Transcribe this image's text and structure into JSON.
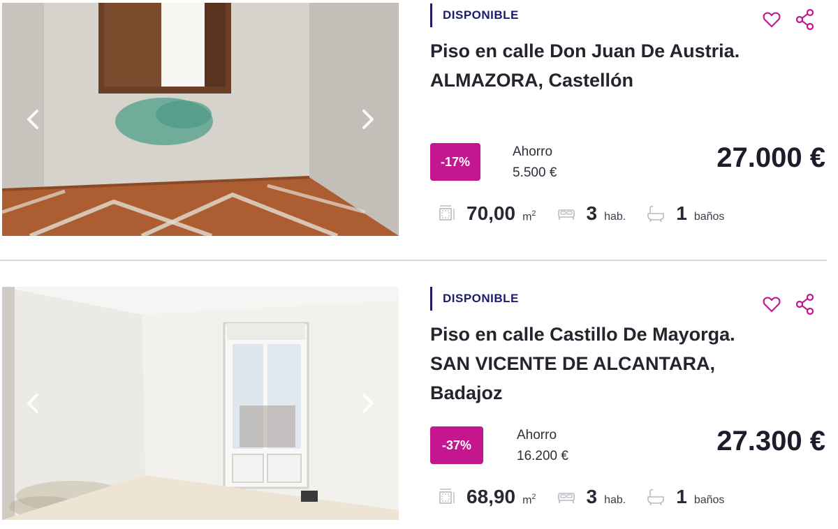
{
  "listings": [
    {
      "status": "DISPONIBLE",
      "title_line1": "Piso en calle Don Juan De Austria.",
      "title_line2": "ALMAZORA, Castellón",
      "title_line3": "",
      "discount": "-17%",
      "savings_label": "Ahorro",
      "savings_value": "5.500 €",
      "price": "27.000 €",
      "area": "70,00",
      "area_unit": "m",
      "area_sup": "2",
      "rooms": "3",
      "rooms_unit": "hab.",
      "baths": "1",
      "baths_unit": "baños",
      "icons": {
        "favorite": "heart-outline-icon",
        "share": "share-icon",
        "prev": "chevron-left-icon",
        "next": "chevron-right-icon",
        "area": "area-icon",
        "rooms": "bed-icon",
        "baths": "bathtub-icon"
      }
    },
    {
      "status": "DISPONIBLE",
      "title_line1": "Piso en calle Castillo De Mayorga.",
      "title_line2": "SAN VICENTE DE ALCANTARA,",
      "title_line3": "Badajoz",
      "discount": "-37%",
      "savings_label": "Ahorro",
      "savings_value": "16.200 €",
      "price": "27.300 €",
      "area": "68,90",
      "area_unit": "m",
      "area_sup": "2",
      "rooms": "3",
      "rooms_unit": "hab.",
      "baths": "1",
      "baths_unit": "baños",
      "icons": {
        "favorite": "heart-outline-icon",
        "share": "share-icon",
        "prev": "chevron-left-icon",
        "next": "chevron-right-icon",
        "area": "area-icon",
        "rooms": "bed-icon",
        "baths": "bathtub-icon"
      }
    }
  ],
  "colors": {
    "accent": "#c4168f",
    "status": "#1e1b6b",
    "text": "#1c1c2b",
    "divider": "#d8d8dc"
  }
}
